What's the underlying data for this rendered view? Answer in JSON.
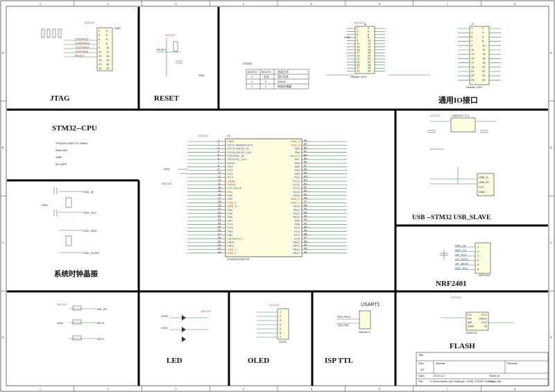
{
  "border": {
    "columns": [
      "1",
      "2",
      "3",
      "4",
      "5",
      "6",
      "7",
      "8"
    ],
    "rows": [
      "A",
      "B",
      "C",
      "D"
    ]
  },
  "sections": {
    "jtag": "JTAG",
    "reset": "RESET",
    "gpio": "通用IO接口",
    "cpu": "STM32--CPU",
    "usb": "USB --STM32 USB_SLAVE",
    "clock": "系统时钟晶振",
    "nrf": "NRF2401",
    "led": "LED",
    "oled": "OLED",
    "isp": "ISP TTL",
    "flash": "FLASH",
    "usart": "USART1"
  },
  "cpu_info": [
    "STM32F103RCT6   72MHz",
    "RAM 48K",
    "256K",
    "64-LQFP"
  ],
  "boot_table": {
    "title": "STM32",
    "headers": [
      "BOOT0",
      "BOOT1",
      "启动方式"
    ],
    "rows": [
      [
        "0",
        "无关",
        "用户闪存"
      ],
      [
        "1",
        "0",
        "SRAM"
      ],
      [
        "1",
        "1",
        "系统存储器"
      ]
    ]
  },
  "ic": {
    "ref": "U1",
    "part": "STM32F103RCT6",
    "left_pins": [
      "VBAT",
      "PC13-TAMPER-RTC",
      "PC14-OSC32_IN",
      "PC15-OSC32_OUT",
      "PD0/OSC_IN",
      "PD1/OSC_OUT",
      "NRST",
      "PC0",
      "PC1",
      "PC2",
      "PC3",
      "VSSA",
      "VDDA",
      "PA0-WKUP",
      "PA1",
      "PA2",
      "PA3",
      "VSS_4",
      "VDD_4",
      "PA4",
      "PA5",
      "PA6",
      "PA7",
      "PC4",
      "PC5",
      "PB0",
      "PB1",
      "PB2/BOOT1",
      "PB10",
      "PB11",
      "VSS_1",
      "VDD_1"
    ],
    "right_pins": [
      "VDD_3",
      "VSS_3",
      "PB9",
      "PB8",
      "BOOT0",
      "PB7",
      "PB6",
      "PB5",
      "PB4",
      "PB3",
      "PD2",
      "PC12",
      "PC11",
      "PC10",
      "PA15",
      "PA14",
      "VDD_2",
      "VSS_2",
      "PA13",
      "PA12",
      "PA11",
      "PA10",
      "PA9",
      "PA8",
      "PC9",
      "PC8",
      "PC7",
      "PC6",
      "PB15",
      "PB14",
      "PB13",
      "PB12"
    ]
  },
  "net_labels": {
    "vcc": "VCC3.3",
    "gnd": "GND",
    "osc_in": "OSC_IN",
    "osc_out": "OSC_OUT",
    "osc32_in": "OSC_32IN",
    "osc32_out": "OSC_32OUT",
    "reset_net": "RESET",
    "wk_up": "WK_UP",
    "key0": "KEY0",
    "key1": "KEY1"
  },
  "jtag_pins": [
    "JTDI/PA15",
    "JTMS/PA13",
    "JTCK/PA14",
    "JTDO/PB3",
    "RESET"
  ],
  "header_left": {
    "ref": "J6",
    "name": "Header 15X2"
  },
  "header_right": {
    "ref": "J7",
    "name": "Header 13X2"
  },
  "oled_header": "OLED",
  "usart_header": "Header 4",
  "usart_pins": [
    "RXD PA10",
    "TXD PA9"
  ],
  "nrf_header": "NRF2401",
  "nrf_pins": [
    "NRF_CE",
    "NRF_CS",
    "SPI_SCK",
    "SPI_MOSI",
    "SPI_MISO",
    "NRF_IRQ"
  ],
  "flash_chip": "W25X16",
  "flash_pins": [
    "CS",
    "DO",
    "WP",
    "GND",
    "VCC",
    "HOLD",
    "CLK",
    "DI"
  ],
  "regulator": "AMS1117-3.3",
  "usb_labels": [
    "USB_D-",
    "USB_D+",
    "VCC",
    "GND"
  ],
  "led_labels": [
    "LED0",
    "LED1"
  ],
  "title_block": {
    "title": "Title",
    "size_label": "Size",
    "size": "A3",
    "number_label": "Number",
    "revision_label": "Revision",
    "date_label": "Date:",
    "date": "2013-4-2",
    "sheet": "Sheet    of",
    "file_label": "File:",
    "file": "C:\\Documents and Settings\\...\\M38_STM32.SchDoc",
    "drawn": "Drawn By:"
  }
}
